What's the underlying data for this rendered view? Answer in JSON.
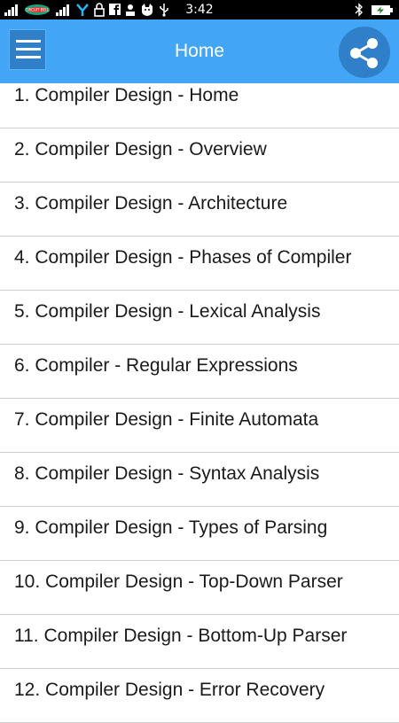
{
  "status_bar": {
    "time": "3:42",
    "carrier_logo_text": "CIRCUIT BELL",
    "icons_left": [
      "signal-icon",
      "carrier-logo-icon",
      "signal-icon",
      "network-share-icon",
      "lock-icon",
      "facebook-icon",
      "person-icon",
      "cat-icon",
      "usb-icon"
    ],
    "icons_right": [
      "bluetooth-icon",
      "battery-charging-icon"
    ]
  },
  "app_bar": {
    "title": "Home",
    "menu_icon": "hamburger-menu-icon",
    "share_icon": "share-icon",
    "color": "#42a5f5",
    "button_color": "#2f7fc9"
  },
  "topics": [
    {
      "label": "1. Compiler Design - Home"
    },
    {
      "label": "2. Compiler Design - Overview"
    },
    {
      "label": "3. Compiler Design - Architecture"
    },
    {
      "label": "4. Compiler Design - Phases of Compiler"
    },
    {
      "label": "5. Compiler Design - Lexical Analysis"
    },
    {
      "label": "6. Compiler - Regular Expressions"
    },
    {
      "label": "7. Compiler Design - Finite Automata"
    },
    {
      "label": "8. Compiler Design - Syntax Analysis"
    },
    {
      "label": "9. Compiler Design - Types of Parsing"
    },
    {
      "label": "10. Compiler Design - Top-Down Parser"
    },
    {
      "label": "11. Compiler Design - Bottom-Up Parser"
    },
    {
      "label": "12. Compiler Design - Error Recovery"
    }
  ]
}
